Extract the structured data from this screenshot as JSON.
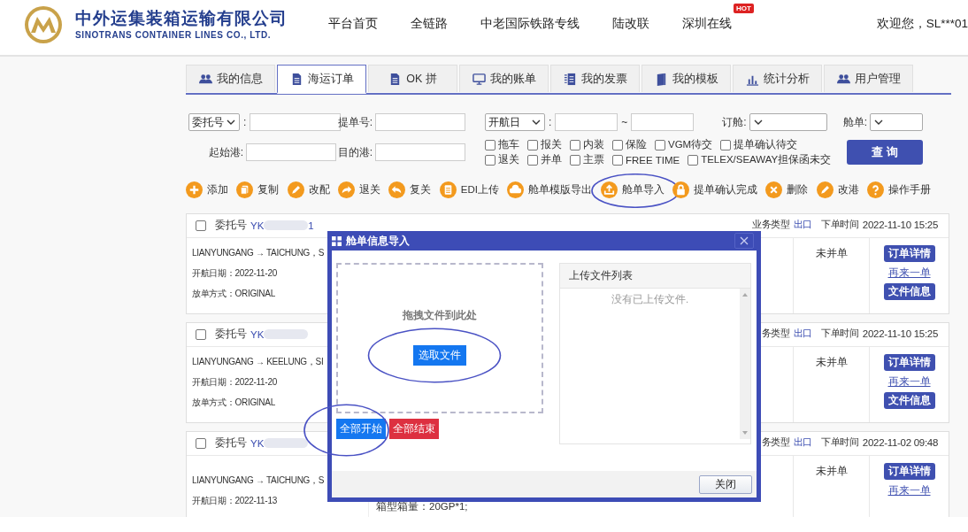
{
  "header": {
    "company_name": "中外运集装箱运输有限公司",
    "company_name_en": "SINOTRANS CONTAINER LINES CO., LTD.",
    "nav": [
      {
        "label": "平台首页"
      },
      {
        "label": "全链路"
      },
      {
        "label": "中老国际铁路专线"
      },
      {
        "label": "陆改联"
      },
      {
        "label": "深圳在线",
        "badge": "HOT"
      }
    ],
    "welcome": "欢迎您，SL***01"
  },
  "tabs": [
    {
      "label": "我的信息",
      "selected": false
    },
    {
      "label": "海运订单",
      "selected": true
    },
    {
      "label": "OK 拼",
      "selected": false
    },
    {
      "label": "我的账单",
      "selected": false
    },
    {
      "label": "我的发票",
      "selected": false
    },
    {
      "label": "我的模板",
      "selected": false
    },
    {
      "label": "统计分析",
      "selected": false
    },
    {
      "label": "用户管理",
      "selected": false
    }
  ],
  "search": {
    "order_no_select": "委托号",
    "order_no_colon": ":",
    "bl_no_label": "提单号:",
    "date_select": "开航日",
    "date_colon": ":",
    "date_separator": "~",
    "booking_label": "订舱:",
    "manifest_label": "舱单:",
    "departure_port_label": "起始港:",
    "destination_port_label": "目的港:",
    "checkbox_rows": [
      {
        "items": [
          {
            "label": "拖车",
            "checked": false
          },
          {
            "label": "报关",
            "checked": false
          },
          {
            "label": "内装",
            "checked": false
          },
          {
            "label": "保险",
            "checked": false
          },
          {
            "label": "VGM待交",
            "checked": false
          },
          {
            "label": "提单确认待交",
            "checked": false
          }
        ]
      },
      {
        "items": [
          {
            "label": "退关",
            "checked": false
          },
          {
            "label": "并单",
            "checked": false
          },
          {
            "label": "主票",
            "checked": false
          },
          {
            "label": "FREE TIME",
            "checked": false
          },
          {
            "label": "TELEX/SEAWAY担保函未交",
            "checked": false
          }
        ]
      }
    ],
    "search_button": "查 询"
  },
  "toolbar": [
    {
      "label": "添加",
      "highlighted": false
    },
    {
      "label": "复制",
      "highlighted": false
    },
    {
      "label": "改配",
      "highlighted": false
    },
    {
      "label": "退关",
      "highlighted": false
    },
    {
      "label": "复关",
      "highlighted": false
    },
    {
      "label": "EDI上传",
      "highlighted": false
    },
    {
      "label": "舱单模版导出",
      "highlighted": false
    },
    {
      "label": "舱单导入",
      "highlighted": true
    },
    {
      "label": "提单确认完成",
      "highlighted": false
    },
    {
      "label": "删除",
      "highlighted": false
    },
    {
      "label": "改港",
      "highlighted": false
    },
    {
      "label": "操作手册",
      "highlighted": false
    }
  ],
  "orders": [
    {
      "checked": false,
      "order_no_label": "委托号",
      "order_no_prefix": "YK",
      "order_no_suffix": "1",
      "header_fields": [
        {
          "kind": "business_type",
          "label": "业务类型",
          "value": "出口"
        }
      ],
      "order_time_label": "下单时间",
      "order_time": "2022-11-10 15:25",
      "info_lines": [
        "LIANYUNGANG → TAICHUNG，S",
        "开航日期：2022-11-20",
        "放单方式：ORIGINAL"
      ],
      "merge_status": "未并单",
      "actions": [
        {
          "kind": "button",
          "label": "订单详情"
        },
        {
          "kind": "link",
          "label": "再来一单"
        },
        {
          "kind": "button",
          "label": "文件信息"
        }
      ]
    },
    {
      "checked": false,
      "order_no_label": "委托号",
      "order_no_prefix": "YK",
      "header_fields": [
        {
          "kind": "business_type",
          "label": "务类型",
          "value": "出口"
        }
      ],
      "order_time_label": "下单时间",
      "order_time": "2022-11-10 15:25",
      "info_lines": [
        "LIANYUNGANG → KEELUNG，SI",
        "开航日期：2022-11-20",
        "放单方式：ORIGINAL"
      ],
      "merge_status": "未并单",
      "actions": [
        {
          "kind": "button",
          "label": "订单详情"
        },
        {
          "kind": "link",
          "label": "再来一单"
        },
        {
          "kind": "button",
          "label": "文件信息"
        }
      ]
    },
    {
      "checked": false,
      "order_no_label": "委托号",
      "order_no_prefix": "YK",
      "header_fields": [
        {
          "kind": "business_type",
          "label": "务类型",
          "value": "出口"
        }
      ],
      "order_time_label": "下单时间",
      "order_time": "2022-11-02 09:48",
      "info_lines": [
        "LIANYUNGANG → TAICHUNG，S",
        "开航日期：2022-11-13"
      ],
      "detail_lines": [
        "箱型箱量：20GP*1;"
      ],
      "merge_status": "未并单",
      "actions": [
        {
          "kind": "button",
          "label": "订单详情"
        },
        {
          "kind": "link",
          "label": "再来一单"
        }
      ]
    }
  ],
  "dialog": {
    "title": "舱单信息导入",
    "drop_hint": "拖拽文件到此处",
    "pick_button": {
      "label": "选取文件",
      "highlighted": true
    },
    "start_button": {
      "label": "全部开始",
      "highlighted": true
    },
    "stop_button": {
      "label": "全部结束",
      "highlighted": false
    },
    "file_list_title": "上传文件列表",
    "file_list_empty": "没有已上传文件.",
    "close_button": "关闭"
  }
}
